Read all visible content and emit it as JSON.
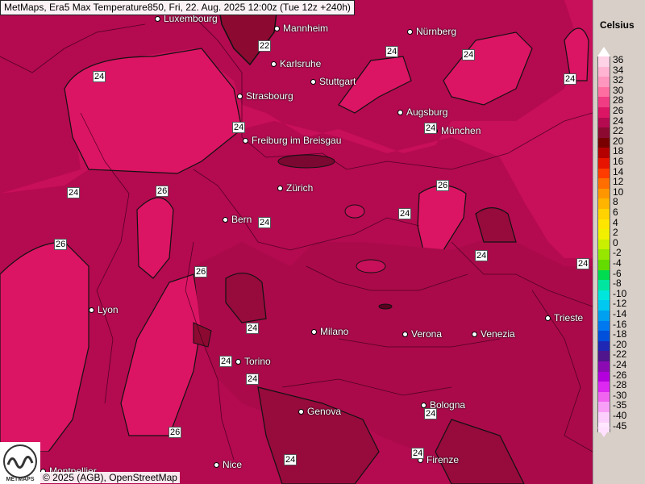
{
  "header": {
    "title": "MetMaps, Era5 Max Temperature850, Fri, 22. Aug. 2025 12:00z (Tue 12z +240h)"
  },
  "cities": [
    {
      "name": "Luxembourg"
    },
    {
      "name": "Mannheim"
    },
    {
      "name": "Nürnberg"
    },
    {
      "name": "Karlsruhe"
    },
    {
      "name": "Stuttgart"
    },
    {
      "name": "Strasbourg"
    },
    {
      "name": "Augsburg"
    },
    {
      "name": "München"
    },
    {
      "name": "Freiburg im Breisgau"
    },
    {
      "name": "Zürich"
    },
    {
      "name": "Bern"
    },
    {
      "name": "Lyon"
    },
    {
      "name": "Milano"
    },
    {
      "name": "Verona"
    },
    {
      "name": "Venezia"
    },
    {
      "name": "Trieste"
    },
    {
      "name": "Torino"
    },
    {
      "name": "Genova"
    },
    {
      "name": "Bologna"
    },
    {
      "name": "Nice"
    },
    {
      "name": "Firenze"
    },
    {
      "name": "Montpellier"
    }
  ],
  "isolines": [
    "22",
    "24",
    "24",
    "24",
    "24",
    "24",
    "24",
    "26",
    "26",
    "24",
    "24",
    "24",
    "26",
    "24",
    "26",
    "24",
    "24",
    "24",
    "24",
    "26",
    "24",
    "24",
    "24",
    "24"
  ],
  "legend": {
    "unit": "Celsius",
    "levels": [
      {
        "label": "36",
        "color": "#ffd2e6"
      },
      {
        "label": "34",
        "color": "#ffb4d2"
      },
      {
        "label": "32",
        "color": "#ff96be"
      },
      {
        "label": "30",
        "color": "#ff6ea0"
      },
      {
        "label": "28",
        "color": "#f03c82"
      },
      {
        "label": "26",
        "color": "#dc1464"
      },
      {
        "label": "24",
        "color": "#b40a50"
      },
      {
        "label": "22",
        "color": "#8c0a32"
      },
      {
        "label": "20",
        "color": "#780000"
      },
      {
        "label": "18",
        "color": "#b40000"
      },
      {
        "label": "16",
        "color": "#e61400"
      },
      {
        "label": "14",
        "color": "#ff3c00"
      },
      {
        "label": "12",
        "color": "#ff6e00"
      },
      {
        "label": "10",
        "color": "#ff9600"
      },
      {
        "label": "8",
        "color": "#ffb400"
      },
      {
        "label": "6",
        "color": "#ffd200"
      },
      {
        "label": "4",
        "color": "#ffe600"
      },
      {
        "label": "2",
        "color": "#f0f000"
      },
      {
        "label": "0",
        "color": "#c8f000"
      },
      {
        "label": "-2",
        "color": "#96e600"
      },
      {
        "label": "-4",
        "color": "#64dc00"
      },
      {
        "label": "-6",
        "color": "#00dc50"
      },
      {
        "label": "-8",
        "color": "#00e6a0"
      },
      {
        "label": "-10",
        "color": "#00e6dc"
      },
      {
        "label": "-12",
        "color": "#00c8f0"
      },
      {
        "label": "-14",
        "color": "#00a0f0"
      },
      {
        "label": "-16",
        "color": "#0078f0"
      },
      {
        "label": "-18",
        "color": "#0050dc"
      },
      {
        "label": "-20",
        "color": "#1e28b4"
      },
      {
        "label": "-22",
        "color": "#50148c"
      },
      {
        "label": "-24",
        "color": "#8c0ab4"
      },
      {
        "label": "-26",
        "color": "#b400dc"
      },
      {
        "label": "-28",
        "color": "#dc28f0"
      },
      {
        "label": "-30",
        "color": "#f064f0"
      },
      {
        "label": "-35",
        "color": "#f8a0f8"
      },
      {
        "label": "-40",
        "color": "#fcd0fc"
      },
      {
        "label": "-45",
        "color": "#ffe8ff"
      }
    ]
  },
  "attribution": "© 2025 (AGB), OpenStreetMap",
  "logo_text": "METMAPS"
}
